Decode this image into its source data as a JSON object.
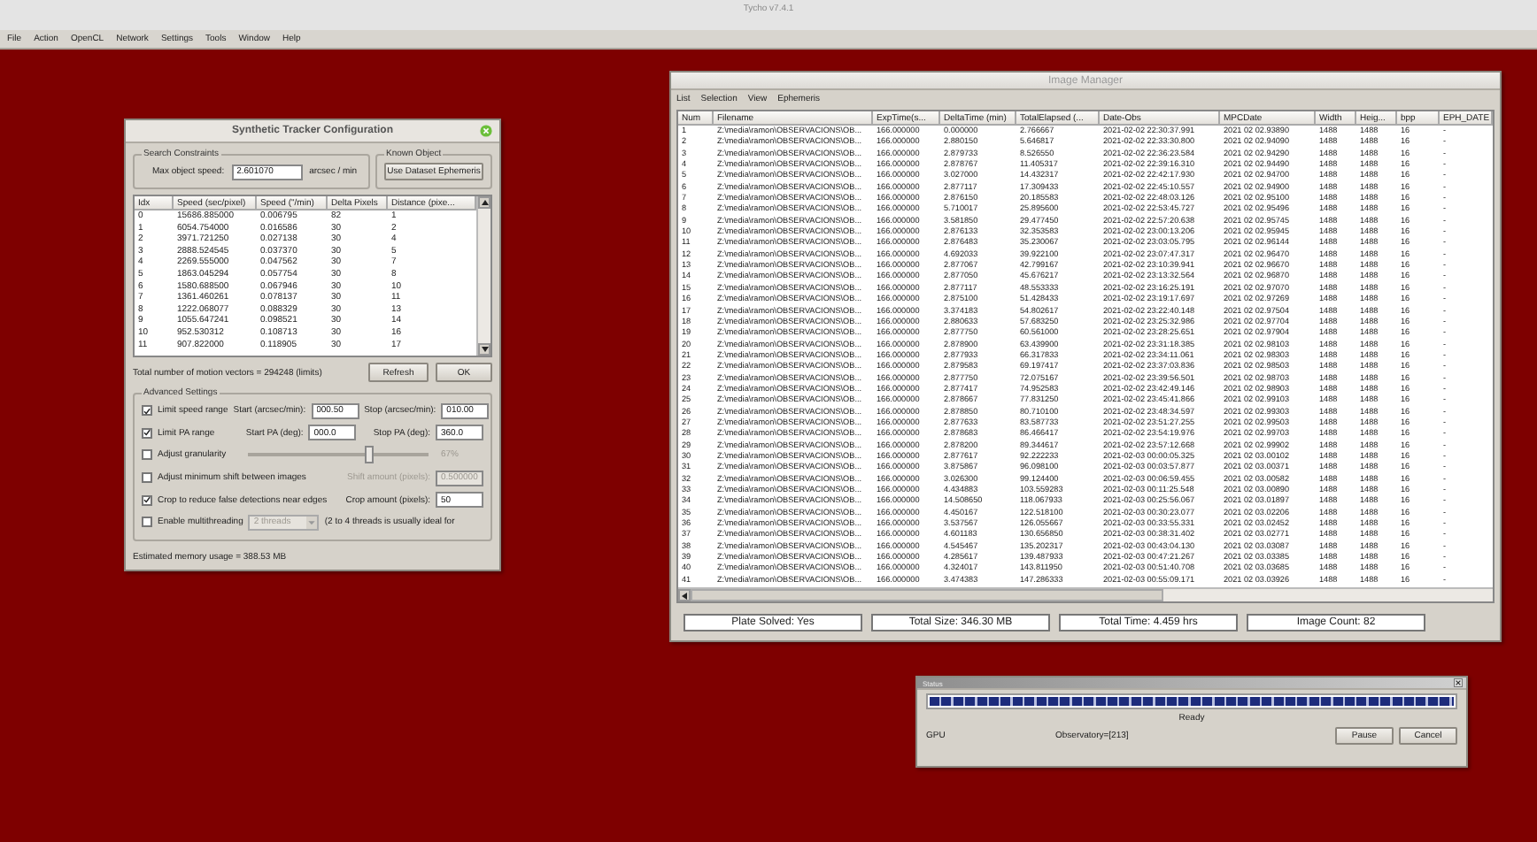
{
  "app": {
    "title": "Tycho v7.4.1",
    "menu": [
      "File",
      "Action",
      "OpenCL",
      "Network",
      "Settings",
      "Tools",
      "Window",
      "Help"
    ]
  },
  "tracker": {
    "title": "Synthetic Tracker Configuration",
    "search": {
      "legend": "Search Constraints",
      "label": "Max object speed:",
      "value": "2.601070",
      "unit": "arcsec / min"
    },
    "known": {
      "legend": "Known Object",
      "button": "Use Dataset Ephemeris"
    },
    "table": {
      "columns": [
        "Idx",
        "Speed (sec/pixel)",
        "Speed (\"/min)",
        "Delta Pixels",
        "Distance (pixe..."
      ],
      "rows": [
        [
          "0",
          "15686.885000",
          "0.006795",
          "82",
          "1"
        ],
        [
          "1",
          "6054.754000",
          "0.016586",
          "30",
          "2"
        ],
        [
          "2",
          "3971.721250",
          "0.027138",
          "30",
          "4"
        ],
        [
          "3",
          "2888.524545",
          "0.037370",
          "30",
          "5"
        ],
        [
          "4",
          "2269.555000",
          "0.047562",
          "30",
          "7"
        ],
        [
          "5",
          "1863.045294",
          "0.057754",
          "30",
          "8"
        ],
        [
          "6",
          "1580.688500",
          "0.067946",
          "30",
          "10"
        ],
        [
          "7",
          "1361.460261",
          "0.078137",
          "30",
          "11"
        ],
        [
          "8",
          "1222.068077",
          "0.088329",
          "30",
          "13"
        ],
        [
          "9",
          "1055.647241",
          "0.098521",
          "30",
          "14"
        ],
        [
          "10",
          "952.530312",
          "0.108713",
          "30",
          "16"
        ],
        [
          "11",
          "907.822000",
          "0.118905",
          "30",
          "17"
        ]
      ]
    },
    "total": "Total number of motion vectors = 294248 (limits)",
    "buttons": [
      "Refresh",
      "OK"
    ],
    "advanced": {
      "legend": "Advanced Settings",
      "options": [
        {
          "kind": "range",
          "label": "Limit speed range",
          "checked": true,
          "fields": [
            {
              "label": "Start (arcsec/min):",
              "value": "000.50"
            },
            {
              "label": "Stop (arcsec/min):",
              "value": "010.00"
            }
          ]
        },
        {
          "kind": "range",
          "label": "Limit PA range",
          "checked": true,
          "fields": [
            {
              "label": "Start PA (deg):",
              "value": "000.0"
            },
            {
              "label": "Stop PA (deg):",
              "value": "360.0"
            }
          ]
        },
        {
          "kind": "slider",
          "label": "Adjust granularity",
          "checked": false,
          "level": 0.67,
          "reading": "67%"
        },
        {
          "kind": "field",
          "label": "Adjust minimum shift between images",
          "checked": false,
          "field": {
            "label": "Shift amount (pixels):",
            "value": "0.500000"
          }
        },
        {
          "kind": "field",
          "label": "Crop to reduce false detections near edges",
          "checked": true,
          "field": {
            "label": "Crop amount (pixels):",
            "value": "50"
          }
        },
        {
          "kind": "select",
          "label": "Enable multithreading",
          "checked": false,
          "value": "2 threads",
          "note": "(2 to 4 threads is usually ideal for"
        }
      ]
    },
    "memory": "Estimated memory usage = 388.53 MB"
  },
  "image_manager": {
    "title": "Image Manager",
    "menu": [
      "List",
      "Selection",
      "View",
      "Ephemeris"
    ],
    "table": {
      "columns": [
        "Num",
        "Filename",
        "ExpTime(s...",
        "DeltaTime (min)",
        "TotalElapsed (...",
        "Date-Obs",
        "MPCDate",
        "Width",
        "Heig...",
        "bpp",
        "EPH_DATE"
      ],
      "rows": [
        [
          "1",
          "Z:\\media\\ramon\\OBSERVACIONS\\OB...",
          "166.000000",
          "0.000000",
          "2.766667",
          "2021-02-02 22:30:37.991",
          "2021 02 02.93890",
          "1488",
          "1488",
          "16",
          "-"
        ],
        [
          "2",
          "Z:\\media\\ramon\\OBSERVACIONS\\OB...",
          "166.000000",
          "2.880150",
          "5.646817",
          "2021-02-02 22:33:30.800",
          "2021 02 02.94090",
          "1488",
          "1488",
          "16",
          "-"
        ],
        [
          "3",
          "Z:\\media\\ramon\\OBSERVACIONS\\OB...",
          "166.000000",
          "2.879733",
          "8.526550",
          "2021-02-02 22:36:23.584",
          "2021 02 02.94290",
          "1488",
          "1488",
          "16",
          "-"
        ],
        [
          "4",
          "Z:\\media\\ramon\\OBSERVACIONS\\OB...",
          "166.000000",
          "2.878767",
          "11.405317",
          "2021-02-02 22:39:16.310",
          "2021 02 02.94490",
          "1488",
          "1488",
          "16",
          "-"
        ],
        [
          "5",
          "Z:\\media\\ramon\\OBSERVACIONS\\OB...",
          "166.000000",
          "3.027000",
          "14.432317",
          "2021-02-02 22:42:17.930",
          "2021 02 02.94700",
          "1488",
          "1488",
          "16",
          "-"
        ],
        [
          "6",
          "Z:\\media\\ramon\\OBSERVACIONS\\OB...",
          "166.000000",
          "2.877117",
          "17.309433",
          "2021-02-02 22:45:10.557",
          "2021 02 02.94900",
          "1488",
          "1488",
          "16",
          "-"
        ],
        [
          "7",
          "Z:\\media\\ramon\\OBSERVACIONS\\OB...",
          "166.000000",
          "2.876150",
          "20.185583",
          "2021-02-02 22:48:03.126",
          "2021 02 02.95100",
          "1488",
          "1488",
          "16",
          "-"
        ],
        [
          "8",
          "Z:\\media\\ramon\\OBSERVACIONS\\OB...",
          "166.000000",
          "5.710017",
          "25.895600",
          "2021-02-02 22:53:45.727",
          "2021 02 02.95496",
          "1488",
          "1488",
          "16",
          "-"
        ],
        [
          "9",
          "Z:\\media\\ramon\\OBSERVACIONS\\OB...",
          "166.000000",
          "3.581850",
          "29.477450",
          "2021-02-02 22:57:20.638",
          "2021 02 02.95745",
          "1488",
          "1488",
          "16",
          "-"
        ],
        [
          "10",
          "Z:\\media\\ramon\\OBSERVACIONS\\OB...",
          "166.000000",
          "2.876133",
          "32.353583",
          "2021-02-02 23:00:13.206",
          "2021 02 02.95945",
          "1488",
          "1488",
          "16",
          "-"
        ],
        [
          "11",
          "Z:\\media\\ramon\\OBSERVACIONS\\OB...",
          "166.000000",
          "2.876483",
          "35.230067",
          "2021-02-02 23:03:05.795",
          "2021 02 02.96144",
          "1488",
          "1488",
          "16",
          "-"
        ],
        [
          "12",
          "Z:\\media\\ramon\\OBSERVACIONS\\OB...",
          "166.000000",
          "4.692033",
          "39.922100",
          "2021-02-02 23:07:47.317",
          "2021 02 02.96470",
          "1488",
          "1488",
          "16",
          "-"
        ],
        [
          "13",
          "Z:\\media\\ramon\\OBSERVACIONS\\OB...",
          "166.000000",
          "2.877067",
          "42.799167",
          "2021-02-02 23:10:39.941",
          "2021 02 02.96670",
          "1488",
          "1488",
          "16",
          "-"
        ],
        [
          "14",
          "Z:\\media\\ramon\\OBSERVACIONS\\OB...",
          "166.000000",
          "2.877050",
          "45.676217",
          "2021-02-02 23:13:32.564",
          "2021 02 02.96870",
          "1488",
          "1488",
          "16",
          "-"
        ],
        [
          "15",
          "Z:\\media\\ramon\\OBSERVACIONS\\OB...",
          "166.000000",
          "2.877117",
          "48.553333",
          "2021-02-02 23:16:25.191",
          "2021 02 02.97070",
          "1488",
          "1488",
          "16",
          "-"
        ],
        [
          "16",
          "Z:\\media\\ramon\\OBSERVACIONS\\OB...",
          "166.000000",
          "2.875100",
          "51.428433",
          "2021-02-02 23:19:17.697",
          "2021 02 02.97269",
          "1488",
          "1488",
          "16",
          "-"
        ],
        [
          "17",
          "Z:\\media\\ramon\\OBSERVACIONS\\OB...",
          "166.000000",
          "3.374183",
          "54.802617",
          "2021-02-02 23:22:40.148",
          "2021 02 02.97504",
          "1488",
          "1488",
          "16",
          "-"
        ],
        [
          "18",
          "Z:\\media\\ramon\\OBSERVACIONS\\OB...",
          "166.000000",
          "2.880633",
          "57.683250",
          "2021-02-02 23:25:32.986",
          "2021 02 02.97704",
          "1488",
          "1488",
          "16",
          "-"
        ],
        [
          "19",
          "Z:\\media\\ramon\\OBSERVACIONS\\OB...",
          "166.000000",
          "2.877750",
          "60.561000",
          "2021-02-02 23:28:25.651",
          "2021 02 02.97904",
          "1488",
          "1488",
          "16",
          "-"
        ],
        [
          "20",
          "Z:\\media\\ramon\\OBSERVACIONS\\OB...",
          "166.000000",
          "2.878900",
          "63.439900",
          "2021-02-02 23:31:18.385",
          "2021 02 02.98103",
          "1488",
          "1488",
          "16",
          "-"
        ],
        [
          "21",
          "Z:\\media\\ramon\\OBSERVACIONS\\OB...",
          "166.000000",
          "2.877933",
          "66.317833",
          "2021-02-02 23:34:11.061",
          "2021 02 02.98303",
          "1488",
          "1488",
          "16",
          "-"
        ],
        [
          "22",
          "Z:\\media\\ramon\\OBSERVACIONS\\OB...",
          "166.000000",
          "2.879583",
          "69.197417",
          "2021-02-02 23:37:03.836",
          "2021 02 02.98503",
          "1488",
          "1488",
          "16",
          "-"
        ],
        [
          "23",
          "Z:\\media\\ramon\\OBSERVACIONS\\OB...",
          "166.000000",
          "2.877750",
          "72.075167",
          "2021-02-02 23:39:56.501",
          "2021 02 02.98703",
          "1488",
          "1488",
          "16",
          "-"
        ],
        [
          "24",
          "Z:\\media\\ramon\\OBSERVACIONS\\OB...",
          "166.000000",
          "2.877417",
          "74.952583",
          "2021-02-02 23:42:49.146",
          "2021 02 02.98903",
          "1488",
          "1488",
          "16",
          "-"
        ],
        [
          "25",
          "Z:\\media\\ramon\\OBSERVACIONS\\OB...",
          "166.000000",
          "2.878667",
          "77.831250",
          "2021-02-02 23:45:41.866",
          "2021 02 02.99103",
          "1488",
          "1488",
          "16",
          "-"
        ],
        [
          "26",
          "Z:\\media\\ramon\\OBSERVACIONS\\OB...",
          "166.000000",
          "2.878850",
          "80.710100",
          "2021-02-02 23:48:34.597",
          "2021 02 02.99303",
          "1488",
          "1488",
          "16",
          "-"
        ],
        [
          "27",
          "Z:\\media\\ramon\\OBSERVACIONS\\OB...",
          "166.000000",
          "2.877633",
          "83.587733",
          "2021-02-02 23:51:27.255",
          "2021 02 02.99503",
          "1488",
          "1488",
          "16",
          "-"
        ],
        [
          "28",
          "Z:\\media\\ramon\\OBSERVACIONS\\OB...",
          "166.000000",
          "2.878683",
          "86.466417",
          "2021-02-02 23:54:19.976",
          "2021 02 02.99703",
          "1488",
          "1488",
          "16",
          "-"
        ],
        [
          "29",
          "Z:\\media\\ramon\\OBSERVACIONS\\OB...",
          "166.000000",
          "2.878200",
          "89.344617",
          "2021-02-02 23:57:12.668",
          "2021 02 02.99902",
          "1488",
          "1488",
          "16",
          "-"
        ],
        [
          "30",
          "Z:\\media\\ramon\\OBSERVACIONS\\OB...",
          "166.000000",
          "2.877617",
          "92.222233",
          "2021-02-03 00:00:05.325",
          "2021 02 03.00102",
          "1488",
          "1488",
          "16",
          "-"
        ],
        [
          "31",
          "Z:\\media\\ramon\\OBSERVACIONS\\OB...",
          "166.000000",
          "3.875867",
          "96.098100",
          "2021-02-03 00:03:57.877",
          "2021 02 03.00371",
          "1488",
          "1488",
          "16",
          "-"
        ],
        [
          "32",
          "Z:\\media\\ramon\\OBSERVACIONS\\OB...",
          "166.000000",
          "3.026300",
          "99.124400",
          "2021-02-03 00:06:59.455",
          "2021 02 03.00582",
          "1488",
          "1488",
          "16",
          "-"
        ],
        [
          "33",
          "Z:\\media\\ramon\\OBSERVACIONS\\OB...",
          "166.000000",
          "4.434883",
          "103.559283",
          "2021-02-03 00:11:25.548",
          "2021 02 03.00890",
          "1488",
          "1488",
          "16",
          "-"
        ],
        [
          "34",
          "Z:\\media\\ramon\\OBSERVACIONS\\OB...",
          "166.000000",
          "14.508650",
          "118.067933",
          "2021-02-03 00:25:56.067",
          "2021 02 03.01897",
          "1488",
          "1488",
          "16",
          "-"
        ],
        [
          "35",
          "Z:\\media\\ramon\\OBSERVACIONS\\OB...",
          "166.000000",
          "4.450167",
          "122.518100",
          "2021-02-03 00:30:23.077",
          "2021 02 03.02206",
          "1488",
          "1488",
          "16",
          "-"
        ],
        [
          "36",
          "Z:\\media\\ramon\\OBSERVACIONS\\OB...",
          "166.000000",
          "3.537567",
          "126.055667",
          "2021-02-03 00:33:55.331",
          "2021 02 03.02452",
          "1488",
          "1488",
          "16",
          "-"
        ],
        [
          "37",
          "Z:\\media\\ramon\\OBSERVACIONS\\OB...",
          "166.000000",
          "4.601183",
          "130.656850",
          "2021-02-03 00:38:31.402",
          "2021 02 03.02771",
          "1488",
          "1488",
          "16",
          "-"
        ],
        [
          "38",
          "Z:\\media\\ramon\\OBSERVACIONS\\OB...",
          "166.000000",
          "4.545467",
          "135.202317",
          "2021-02-03 00:43:04.130",
          "2021 02 03.03087",
          "1488",
          "1488",
          "16",
          "-"
        ],
        [
          "39",
          "Z:\\media\\ramon\\OBSERVACIONS\\OB...",
          "166.000000",
          "4.285617",
          "139.487933",
          "2021-02-03 00:47:21.267",
          "2021 02 03.03385",
          "1488",
          "1488",
          "16",
          "-"
        ],
        [
          "40",
          "Z:\\media\\ramon\\OBSERVACIONS\\OB...",
          "166.000000",
          "4.324017",
          "143.811950",
          "2021-02-03 00:51:40.708",
          "2021 02 03.03685",
          "1488",
          "1488",
          "16",
          "-"
        ],
        [
          "41",
          "Z:\\media\\ramon\\OBSERVACIONS\\OB...",
          "166.000000",
          "3.474383",
          "147.286333",
          "2021-02-03 00:55:09.171",
          "2021 02 03.03926",
          "1488",
          "1488",
          "16",
          "-"
        ]
      ]
    },
    "status": [
      "Plate Solved: Yes",
      "Total Size: 346.30 MB",
      "Total Time: 4.459 hrs",
      "Image Count: 82"
    ]
  },
  "status_window": {
    "title": "Status",
    "progress": {
      "level": 1
    },
    "message": "Ready",
    "device": "GPU",
    "observatory": "Observatory=[213]",
    "buttons": [
      "Pause",
      "Cancel"
    ]
  }
}
